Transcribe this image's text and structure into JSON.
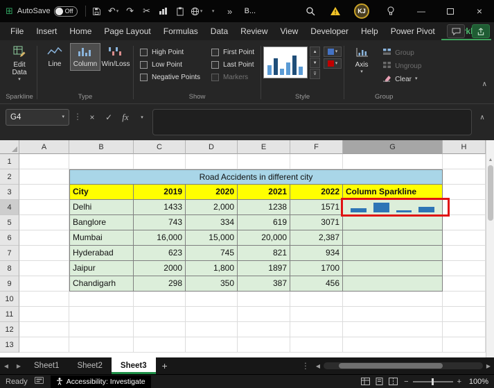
{
  "titlebar": {
    "autosave": {
      "label": "AutoSave",
      "state": "Off"
    },
    "workbook_label": "B...",
    "avatar_initials": "KJ"
  },
  "menubar": {
    "items": [
      {
        "label": "File"
      },
      {
        "label": "Insert"
      },
      {
        "label": "Home"
      },
      {
        "label": "Page Layout"
      },
      {
        "label": "Formulas"
      },
      {
        "label": "Data"
      },
      {
        "label": "Review"
      },
      {
        "label": "View"
      },
      {
        "label": "Developer"
      },
      {
        "label": "Help"
      },
      {
        "label": "Power Pivot"
      },
      {
        "label": "Sparkline",
        "active": true
      }
    ]
  },
  "ribbon": {
    "sparkline_group": {
      "label": "Sparkline",
      "edit_data_label": "Edit Data"
    },
    "type_group": {
      "label": "Type",
      "buttons": [
        {
          "label": "Line",
          "selected": false
        },
        {
          "label": "Column",
          "selected": true
        },
        {
          "label": "Win/Loss",
          "selected": false
        }
      ]
    },
    "show_group": {
      "label": "Show",
      "checkboxes": [
        {
          "label": "High Point",
          "checked": false,
          "disabled": false
        },
        {
          "label": "First Point",
          "checked": false,
          "disabled": false
        },
        {
          "label": "Low Point",
          "checked": false,
          "disabled": false
        },
        {
          "label": "Last Point",
          "checked": false,
          "disabled": false
        },
        {
          "label": "Negative Points",
          "checked": false,
          "disabled": false
        },
        {
          "label": "Markers",
          "checked": false,
          "disabled": true
        }
      ]
    },
    "style_group": {
      "label": "Style"
    },
    "group_group": {
      "label": "Group",
      "axis_label": "Axis",
      "items": [
        {
          "label": "Group",
          "disabled": true,
          "caret": false
        },
        {
          "label": "Ungroup",
          "disabled": true,
          "caret": false
        },
        {
          "label": "Clear",
          "disabled": false,
          "caret": true
        }
      ]
    }
  },
  "formula_bar": {
    "name_box": "G4",
    "formula_value": ""
  },
  "grid": {
    "column_headers": [
      "A",
      "B",
      "C",
      "D",
      "E",
      "F",
      "G",
      "H"
    ],
    "selected_column": "G",
    "row_headers": [
      "1",
      "2",
      "3",
      "4",
      "5",
      "6",
      "7",
      "8",
      "9",
      "10",
      "11",
      "12",
      "13"
    ],
    "selected_row": "4",
    "title_cell": {
      "text": "Road Accidents in different city",
      "range": "B2:G2"
    },
    "header_row": [
      "City",
      "2019",
      "2020",
      "2021",
      "2022",
      "Column Sparkline"
    ],
    "data_rows": [
      {
        "city": "Delhi",
        "values": [
          "1433",
          "2,000",
          "1238",
          "1571"
        ]
      },
      {
        "city": "Banglore",
        "values": [
          "743",
          "334",
          "619",
          "3071"
        ]
      },
      {
        "city": "Mumbai",
        "values": [
          "16,000",
          "15,000",
          "20,000",
          "2,387"
        ]
      },
      {
        "city": "Hyderabad",
        "values": [
          "623",
          "745",
          "821",
          "934"
        ]
      },
      {
        "city": "Jaipur",
        "values": [
          "2000",
          "1,800",
          "1897",
          "1700"
        ]
      },
      {
        "city": "Chandigarh",
        "values": [
          "298",
          "350",
          "387",
          "456"
        ]
      }
    ],
    "sparkline": {
      "cell": "G4",
      "type": "column",
      "values": [
        1433,
        2000,
        1238,
        1571
      ],
      "color": "#2E75B6"
    }
  },
  "sheet_tabs": {
    "tabs": [
      {
        "label": "Sheet1",
        "active": false
      },
      {
        "label": "Sheet2",
        "active": false
      },
      {
        "label": "Sheet3",
        "active": true
      }
    ],
    "add_label": "+"
  },
  "status_bar": {
    "ready_label": "Ready",
    "accessibility_label": "Accessibility: Investigate",
    "zoom_label": "100%"
  },
  "colors": {
    "accent_green": "#4CB86D",
    "header_yellow": "#FFFF00",
    "title_blue": "#A9D6E8",
    "data_green": "#DCEEDA",
    "sparkline_blue": "#2E75B6",
    "annotation_red": "#E01212"
  }
}
